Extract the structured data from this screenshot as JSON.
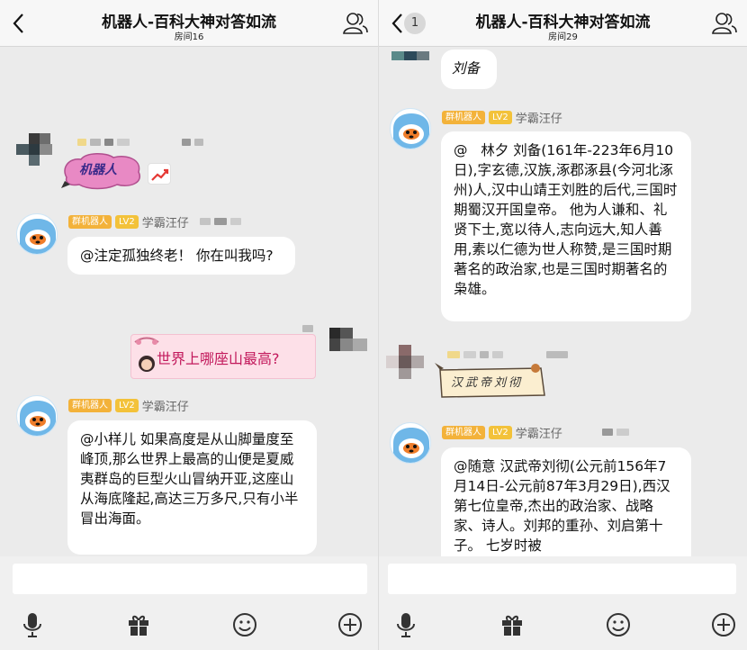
{
  "left": {
    "title": "机器人-百科大神对答如流",
    "room": "房间16",
    "sticker_text": "机器人",
    "messages": [
      {
        "group_tag": "群机器人",
        "level": "LV2",
        "nick": "学霸汪仔",
        "text": "@注定孤独终老！ 你在叫我吗?"
      },
      {
        "text": "世界上哪座山最高?"
      },
      {
        "group_tag": "群机器人",
        "level": "LV2",
        "nick": "学霸汪仔",
        "text": "@小样儿 如果高度是从山脚量度至峰顶,那么世界上最高的山便是夏威夷群岛的巨型火山冒纳开亚,这座山从海底隆起,高达三万多尺,只有小半冒出海面。"
      }
    ]
  },
  "right": {
    "title": "机器人-百科大神对答如流",
    "room": "房间29",
    "unread": "1",
    "messages": [
      {
        "text": "刘备"
      },
      {
        "group_tag": "群机器人",
        "level": "LV2",
        "nick": "学霸汪仔",
        "text": "@   林夕 刘备(161年-223年6月10日),字玄德,汉族,涿郡涿县(今河北涿州)人,汉中山靖王刘胜的后代,三国时期蜀汉开国皇帝。 他为人谦和、礼贤下士,宽以待人,志向远大,知人善用,素以仁德为世人称赞,是三国时期著名的政治家,也是三国时期著名的枭雄。"
      },
      {
        "text": "汉武帝刘彻"
      },
      {
        "group_tag": "群机器人",
        "level": "LV2",
        "nick": "学霸汪仔",
        "text": "@随意 汉武帝刘彻(公元前156年7月14日-公元前87年3月29日),西汉第七位皇帝,杰出的政治家、战略家、诗人。刘邦的重孙、刘启第十子。 七岁时被"
      }
    ]
  },
  "icons": {
    "back": "chevron-left-icon",
    "members": "group-members-icon",
    "mic": "microphone-icon",
    "gift": "gift-icon",
    "emoji": "emoji-icon",
    "plus": "plus-circle-icon"
  },
  "colors": {
    "tag_group": "#f3b23a",
    "tag_level": "#f3c23a",
    "pink_bubble": "#fde0e8",
    "pink_text": "#c2185b",
    "chat_bg": "#ebebeb"
  }
}
